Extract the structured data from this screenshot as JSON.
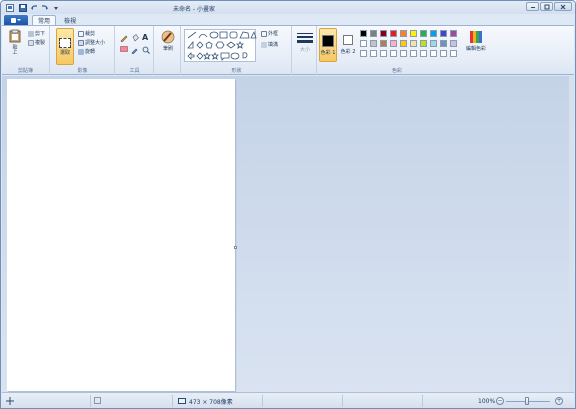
{
  "window": {
    "title": "未命名 - 小畫家"
  },
  "tabs": [
    {
      "label": "常用",
      "active": true
    },
    {
      "label": "檢視",
      "active": false
    }
  ],
  "ribbon": {
    "clipboard": {
      "label": "剪貼簿",
      "paste": "貼上",
      "cut": "剪下",
      "copy": "複製"
    },
    "image": {
      "label": "影像",
      "select": "選取",
      "crop": "裁剪",
      "resize": "調整大小",
      "rotate": "旋轉"
    },
    "tools": {
      "label": "工具",
      "text_icon": "A"
    },
    "brushes": {
      "label": "筆刷"
    },
    "shapes": {
      "label": "形狀",
      "outline": "外框",
      "fill": "填滿"
    },
    "size": {
      "label": "大小"
    },
    "colors": {
      "label": "色彩",
      "color1": "色彩 1",
      "color2": "色彩 2",
      "edit": "編輯色彩",
      "palette_row1": [
        "#000000",
        "#7f7f7f",
        "#880015",
        "#ed1c24",
        "#ff7f27",
        "#fff200",
        "#22b14c",
        "#00a2e8",
        "#3f48cc",
        "#a349a4"
      ],
      "palette_row2": [
        "#ffffff",
        "#c3c3c3",
        "#b97a57",
        "#ffaec9",
        "#ffc90e",
        "#efe4b0",
        "#b5e61d",
        "#99d9ea",
        "#7092be",
        "#c8bfe7"
      ],
      "palette_row3": [
        "#ffffff",
        "#ffffff",
        "#ffffff",
        "#ffffff",
        "#ffffff",
        "#ffffff",
        "#ffffff",
        "#ffffff",
        "#ffffff",
        "#ffffff"
      ]
    }
  },
  "status": {
    "dimensions": "473 × 708像素",
    "zoom": "100%"
  }
}
